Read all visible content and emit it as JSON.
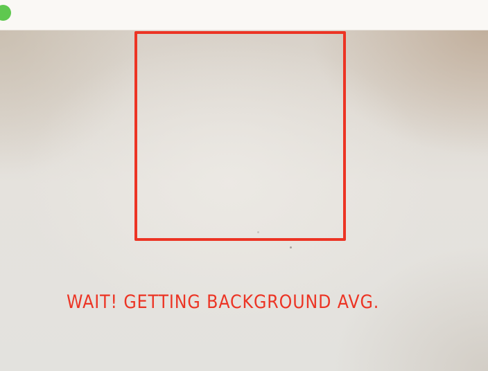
{
  "window": {
    "traffic_light_color": "#5fc84f"
  },
  "camera_feed": {
    "overlay_color": "#ec3424",
    "status_text": "WAIT! GETTING BACKGROUND AVG."
  }
}
